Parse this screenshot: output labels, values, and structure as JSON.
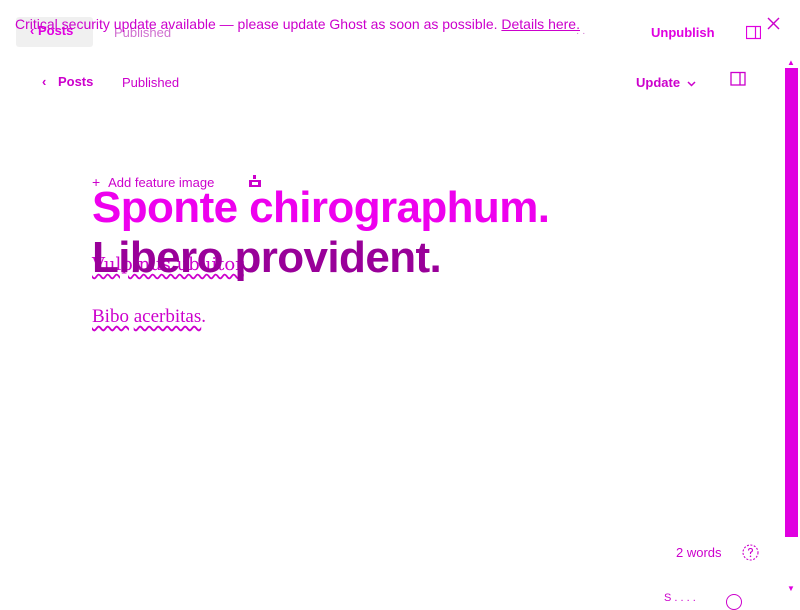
{
  "background_header": {
    "back_label": "Posts",
    "status": "Published",
    "dots": "·  ·",
    "unpublish_label": "Unpublish"
  },
  "banner": {
    "message": "Critical security update available — please update Ghost as soon as possible.",
    "link_text": "Details here."
  },
  "header": {
    "back_label": "Posts",
    "status": "Published",
    "update_label": "Update"
  },
  "editor": {
    "add_feature_image": "Add feature image",
    "underlay_text": "Vulpinus ubuitor",
    "title_line1": "Sponte chirographum.",
    "title_line2": "Libero provident.",
    "body_words": [
      "Bibo",
      "acerbitas",
      "."
    ]
  },
  "footer": {
    "word_count": "2 words",
    "bottom_partial": "S  . .  . ."
  },
  "colors": {
    "accent": "#cc00cc",
    "title_primary": "#ee00ee",
    "title_secondary": "#990099",
    "scrollbar": "#e000e0"
  }
}
